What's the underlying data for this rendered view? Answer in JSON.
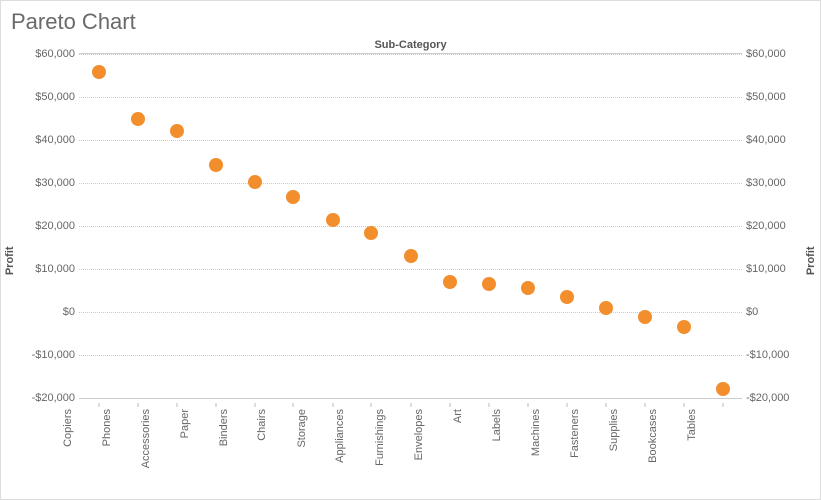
{
  "title": "Pareto Chart",
  "xlabel": "Sub-Category",
  "ylabel_left": "Profit",
  "ylabel_right": "Profit",
  "chart_data": {
    "type": "scatter",
    "categories": [
      "Copiers",
      "Phones",
      "Accessories",
      "Paper",
      "Binders",
      "Chairs",
      "Storage",
      "Appliances",
      "Furnishings",
      "Envelopes",
      "Art",
      "Labels",
      "Machines",
      "Fasteners",
      "Supplies",
      "Bookcases",
      "Tables"
    ],
    "values": [
      55700,
      44800,
      42000,
      34100,
      30300,
      26700,
      21300,
      18300,
      13100,
      7000,
      6600,
      5600,
      3500,
      1000,
      -1200,
      -3500,
      -17800
    ],
    "ylim": [
      -20000,
      60000
    ],
    "yticks": [
      -20000,
      -10000,
      0,
      10000,
      20000,
      30000,
      40000,
      50000,
      60000
    ],
    "ytick_labels": [
      "-$20,000",
      "-$10,000",
      "$0",
      "$10,000",
      "$20,000",
      "$30,000",
      "$40,000",
      "$50,000",
      "$60,000"
    ],
    "title": "Pareto Chart",
    "xlabel": "Sub-Category",
    "ylabel": "Profit",
    "marker_color": "#f28e2c"
  }
}
